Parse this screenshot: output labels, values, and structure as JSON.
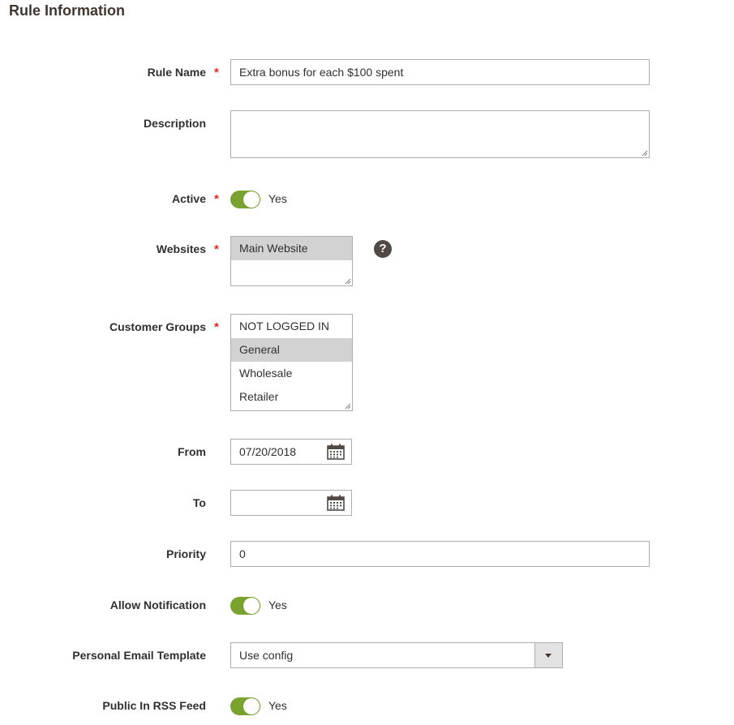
{
  "section": {
    "title": "Rule Information"
  },
  "fields": {
    "rule_name": {
      "label": "Rule Name",
      "required": "*",
      "value": "Extra bonus for each $100 spent"
    },
    "description": {
      "label": "Description",
      "value": ""
    },
    "active": {
      "label": "Active",
      "required": "*",
      "state_text": "Yes"
    },
    "websites": {
      "label": "Websites",
      "required": "*",
      "options": [
        "Main Website"
      ],
      "help_icon": "question-mark-icon",
      "help_glyph": "?"
    },
    "customer_groups": {
      "label": "Customer Groups",
      "required": "*",
      "options": [
        "NOT LOGGED IN",
        "General",
        "Wholesale",
        "Retailer"
      ]
    },
    "from": {
      "label": "From",
      "value": "07/20/2018",
      "icon": "calendar-icon"
    },
    "to": {
      "label": "To",
      "value": "",
      "icon": "calendar-icon"
    },
    "priority": {
      "label": "Priority",
      "value": "0"
    },
    "allow_notification": {
      "label": "Allow Notification",
      "state_text": "Yes"
    },
    "personal_email_template": {
      "label": "Personal Email Template",
      "value": "Use config",
      "icon": "chevron-down-icon"
    },
    "public_in_rss_feed": {
      "label": "Public In RSS Feed",
      "state_text": "Yes"
    }
  },
  "colors": {
    "toggle_on": "#79a22e",
    "required_star": "#e22626",
    "selected_option": "#d2d2d2",
    "help_icon": "#514943"
  }
}
